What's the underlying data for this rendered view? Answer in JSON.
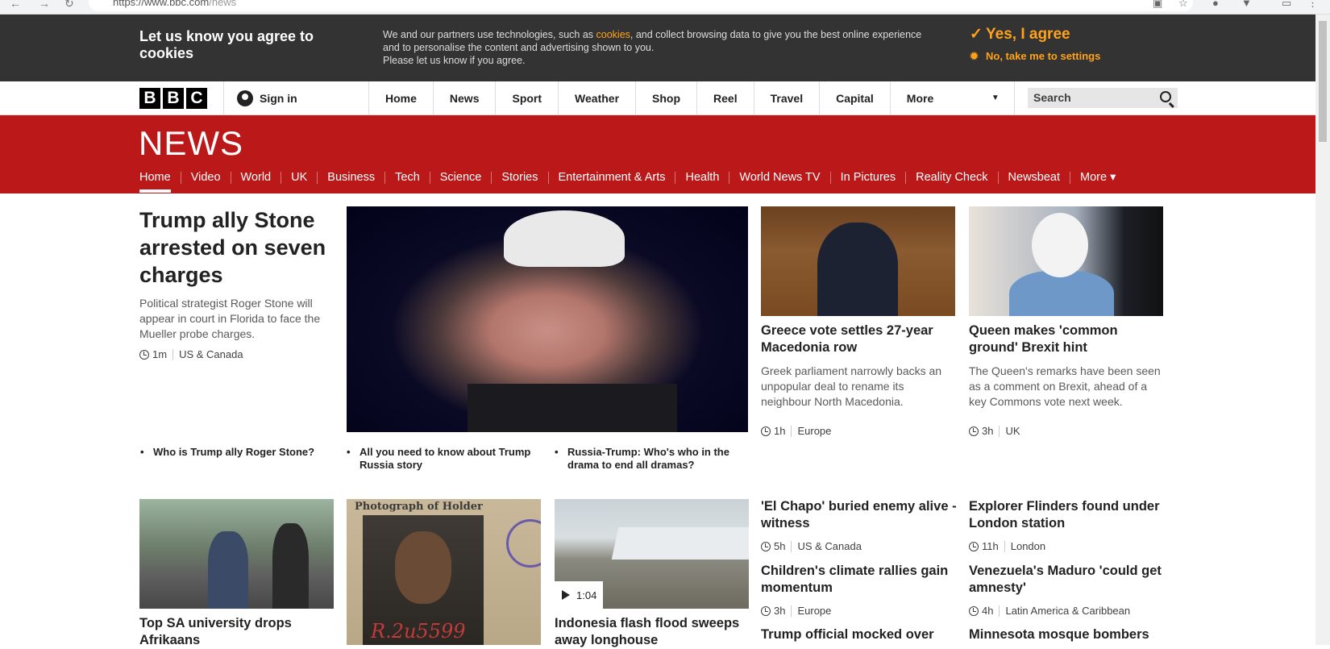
{
  "browser": {
    "url_host": "https://www.bbc.com",
    "url_path": "/news"
  },
  "cookie_banner": {
    "title": "Let us know you agree to cookies",
    "text_before": "We and our partners use technologies, such as ",
    "link": "cookies",
    "text_after": ", and collect browsing data to give you the best online experience and to personalise the content and advertising shown to you.",
    "text_line3": "Please let us know if you agree.",
    "agree": "Yes, I agree",
    "settings": "No, take me to settings"
  },
  "masthead": {
    "logo": [
      "B",
      "B",
      "C"
    ],
    "sign_in": "Sign in",
    "nav": [
      "Home",
      "News",
      "Sport",
      "Weather",
      "Shop",
      "Reel",
      "Travel",
      "Capital"
    ],
    "more": "More",
    "search_placeholder": "Search"
  },
  "news_bar": {
    "wordmark": "NEWS",
    "sections": [
      "Home",
      "Video",
      "World",
      "UK",
      "Business",
      "Tech",
      "Science",
      "Stories",
      "Entertainment & Arts",
      "Health",
      "World News TV",
      "In Pictures",
      "Reality Check",
      "Newsbeat",
      "More ▾"
    ]
  },
  "lead": {
    "title": "Trump ally Stone arrested on seven charges",
    "summary": "Political strategist Roger Stone will appear in court in Florida to face the Mueller probe charges.",
    "time": "1m",
    "region": "US & Canada",
    "related": [
      "Who is Trump ally Roger Stone?",
      "All you need to know about Trump Russia story",
      "Russia-Trump: Who's who in the drama to end all dramas?"
    ]
  },
  "stories": {
    "greece": {
      "title": "Greece vote settles 27-year Macedonia row",
      "summary": "Greek parliament narrowly backs an unpopular deal to rename its neighbour North Macedonia.",
      "time": "1h",
      "region": "Europe"
    },
    "queen": {
      "title": "Queen makes 'common ground' Brexit hint",
      "summary": "The Queen's remarks have been seen as a comment on Brexit, ahead of a key Commons vote next week.",
      "time": "3h",
      "region": "UK"
    },
    "sa": {
      "title": "Top SA university drops Afrikaans"
    },
    "flood": {
      "title": "Indonesia flash flood sweeps away longhouse",
      "duration": "1:04"
    },
    "photo": {
      "caption": "Photograph of Holder",
      "handwriting": "R.2u5599"
    },
    "chapo": {
      "title": "'El Chapo' buried enemy alive - witness",
      "time": "5h",
      "region": "US & Canada"
    },
    "flinders": {
      "title": "Explorer Flinders found under London station",
      "time": "11h",
      "region": "London"
    },
    "climate": {
      "title": "Children's climate rallies gain momentum",
      "time": "3h",
      "region": "Europe"
    },
    "maduro": {
      "title": "Venezuela's Maduro 'could get amnesty'",
      "time": "4h",
      "region": "Latin America & Caribbean"
    },
    "trump_official": {
      "title": "Trump official mocked over"
    },
    "minnesota": {
      "title": "Minnesota mosque bombers"
    }
  },
  "colors": {
    "news_red": "#bb1919",
    "cookie_bg": "#333333",
    "accent_orange": "#ffa31a"
  }
}
